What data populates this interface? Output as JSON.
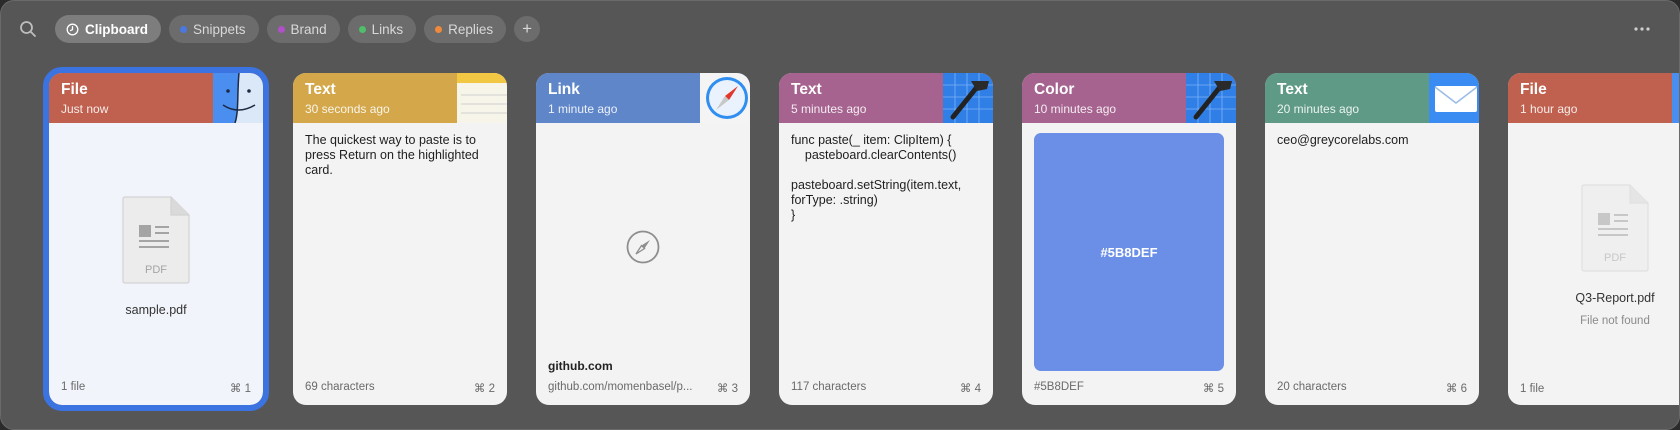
{
  "filters": {
    "active": {
      "label": "Clipboard"
    },
    "items": [
      {
        "label": "Snippets",
        "color": "#4a78e0"
      },
      {
        "label": "Brand",
        "color": "#b04fc8"
      },
      {
        "label": "Links",
        "color": "#4fbf6a"
      },
      {
        "label": "Replies",
        "color": "#f08a3a"
      }
    ]
  },
  "cards": [
    {
      "type": "File",
      "time": "Just now",
      "header_color": "#c0614f",
      "icon": "finder-icon",
      "file_name": "sample.pdf",
      "file_ext": "PDF",
      "count": "1 file",
      "shortcut": "⌘ 1"
    },
    {
      "type": "Text",
      "time": "30 seconds ago",
      "header_color": "#d3a74a",
      "icon": "notes-icon",
      "text": "The quickest way to paste is to press Return on the highlighted card.",
      "count": "69 characters",
      "shortcut": "⌘ 2"
    },
    {
      "type": "Link",
      "time": "1 minute ago",
      "header_color": "#5f86c9",
      "icon": "safari-icon",
      "link_title": "github.com",
      "url": "github.com/momenbasel/p...",
      "shortcut": "⌘ 3"
    },
    {
      "type": "Text",
      "time": "5 minutes ago",
      "header_color": "#a6638f",
      "icon": "xcode-icon",
      "code": "func paste(_ item: ClipItem) {\n    pasteboard.clearContents()\n\npasteboard.setString(item.text,\nforType: .string)\n}",
      "count": "117 characters",
      "shortcut": "⌘ 4"
    },
    {
      "type": "Color",
      "time": "10 minutes ago",
      "header_color": "#a6638f",
      "icon": "xcode-icon",
      "swatch_label": "#5B8DEF",
      "swatch_color": "#6b8ee6",
      "count": "#5B8DEF",
      "shortcut": "⌘ 5"
    },
    {
      "type": "Text",
      "time": "20 minutes ago",
      "header_color": "#5f9a86",
      "icon": "mail-icon",
      "text": "ceo@greycorelabs.com",
      "count": "20 characters",
      "shortcut": "⌘ 6"
    },
    {
      "type": "File",
      "time": "1 hour ago",
      "header_color": "#c0614f",
      "icon": "finder-icon",
      "file_name": "Q3-Report.pdf",
      "file_ext": "PDF",
      "file_status": "File not found",
      "count": "1 file"
    }
  ]
}
